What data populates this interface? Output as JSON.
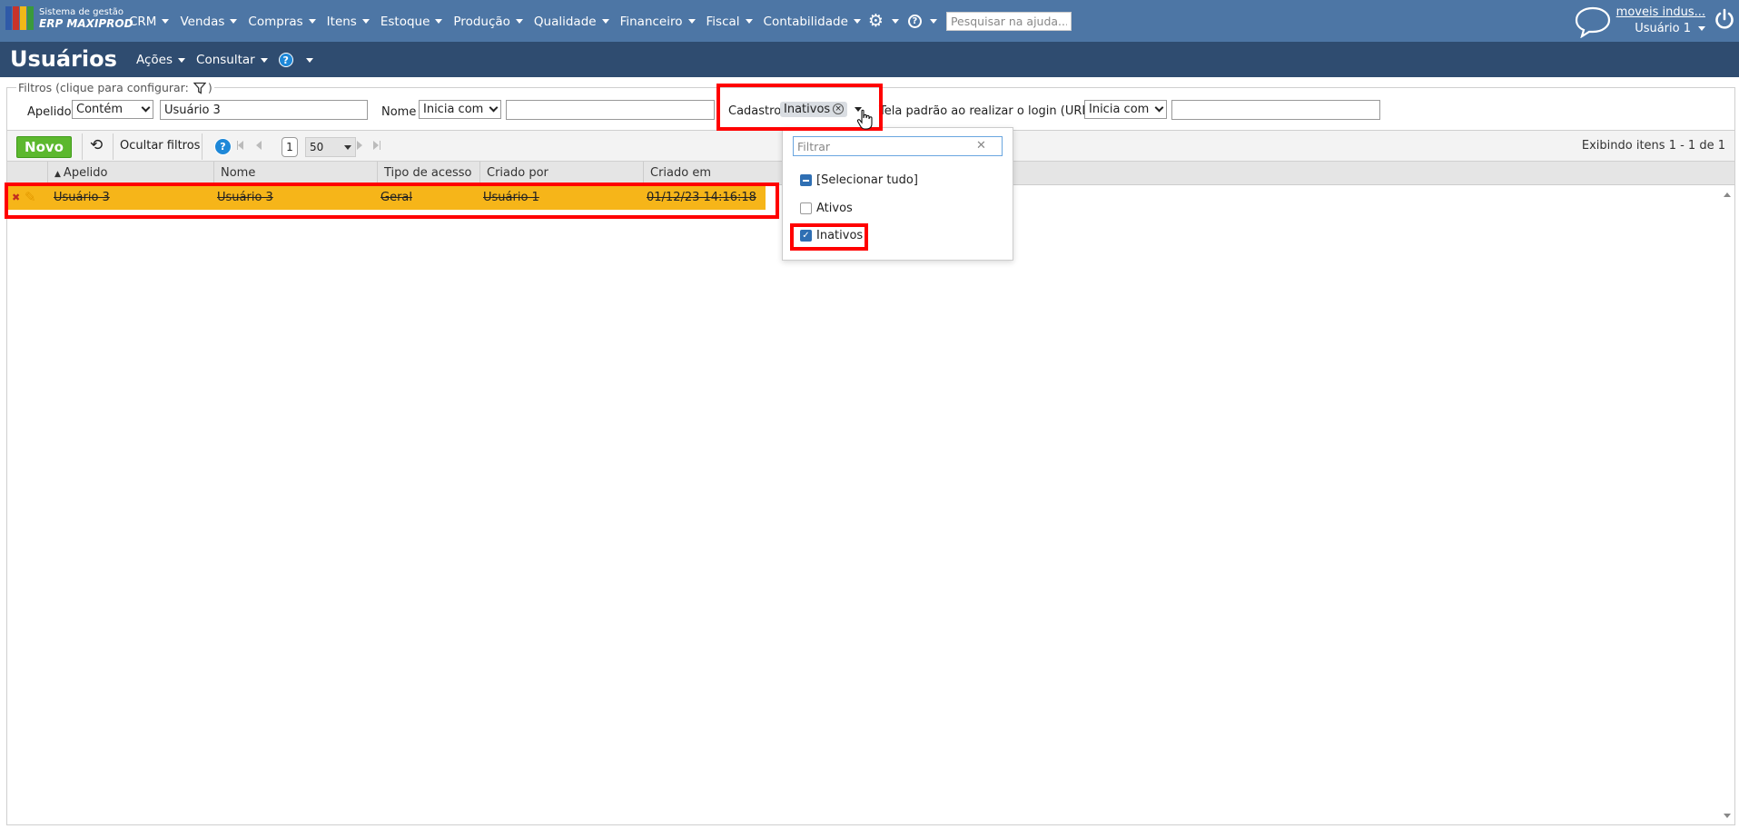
{
  "topbar": {
    "logo_line1": "Sistema de gestão",
    "logo_line2": "ERP MAXIPROD",
    "menu": [
      "CRM",
      "Vendas",
      "Compras",
      "Itens",
      "Estoque",
      "Produção",
      "Qualidade",
      "Financeiro",
      "Fiscal",
      "Contabilidade"
    ],
    "search_placeholder": "Pesquisar na ajuda...",
    "company": "moveis indus...",
    "user": "Usuário 1",
    "bg_color": "#4d76a5"
  },
  "titlebar": {
    "title": "Usuários",
    "menu": [
      "Ações",
      "Consultar"
    ],
    "help_icon": "?",
    "bg_color": "#2f4c70"
  },
  "filters": {
    "legend": "Filtros (clique para configurar:",
    "legend_close": ")",
    "apelido_label": "Apelido",
    "apelido_op": "Contém",
    "apelido_value": "Usuário 3",
    "nome_label": "Nome",
    "nome_op": "Inicia com",
    "nome_value": "",
    "cadastro_label": "Cadastro",
    "cadastro_tag": "Inativos",
    "tela_label": "Tela padrão ao realizar o login (URL)",
    "tela_op": "Inicia com",
    "tela_value": ""
  },
  "toolbar": {
    "new_label": "Novo",
    "hide_filters_label": "Ocultar filtros",
    "page": "1",
    "page_size": "50",
    "info": "Exibindo itens 1 - 1 de 1",
    "new_color": "#5cb82e"
  },
  "grid": {
    "columns": [
      "Apelido",
      "Nome",
      "Tipo de acesso",
      "Criado por",
      "Criado em"
    ],
    "rows": [
      {
        "apelido": "Usuário 3",
        "nome": "Usuário 3",
        "tipo": "Geral",
        "criado_por": "Usuário 1",
        "criado_em": "01/12/23 14:16:18"
      }
    ],
    "row_color": "#f6b519"
  },
  "popup": {
    "filter_placeholder": "Filtrar",
    "options": [
      {
        "label": "[Selecionar tudo]",
        "state": "indeterminate"
      },
      {
        "label": "Ativos",
        "state": "unchecked"
      },
      {
        "label": "Inativos",
        "state": "checked"
      }
    ]
  },
  "highlight_color": "#ff0000",
  "icons": [
    "erp-logo-icon",
    "gear-icon",
    "help-icon",
    "chat-bubble-icon",
    "power-icon",
    "filter-icon",
    "refresh-icon",
    "first-page-icon",
    "prev-page-icon",
    "next-page-icon",
    "last-page-icon",
    "sort-asc-icon",
    "delete-icon",
    "edit-icon",
    "close-icon",
    "check-icon",
    "cursor-hand-icon"
  ]
}
